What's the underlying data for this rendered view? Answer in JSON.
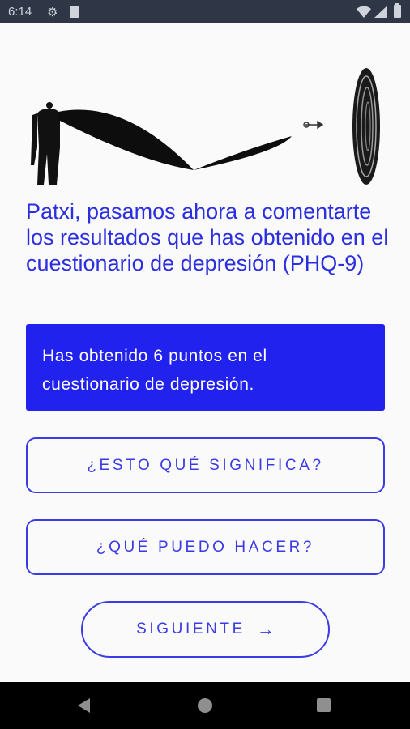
{
  "status_bar": {
    "time": "6:14",
    "icons": [
      "gear-icon",
      "sd-card-icon",
      "wifi-icon",
      "cell-signal-icon",
      "battery-icon"
    ]
  },
  "intro_text": "Patxi, pasamos ahora a comentarte los resultados que has obtenido en el cuestionario de depresión (PHQ-9)",
  "result_card": {
    "text": "Has obtenido 6 puntos en el cuestionario de depresión."
  },
  "buttons": {
    "meaning_label": "¿ESTO QUÉ SIGNIFICA?",
    "what_to_do_label": "¿QUÉ PUEDO HACER?",
    "next_label": "SIGUIENTE",
    "next_icon": "arrow-right-icon"
  },
  "nav_bar": {
    "icons": [
      "back-icon",
      "home-icon",
      "recents-icon"
    ]
  },
  "colors": {
    "accent": "#2b2fe0",
    "card_background": "#2222ee",
    "status_bar": "#2f3646",
    "nav_bar": "#000000",
    "page_background": "#fafafa"
  }
}
